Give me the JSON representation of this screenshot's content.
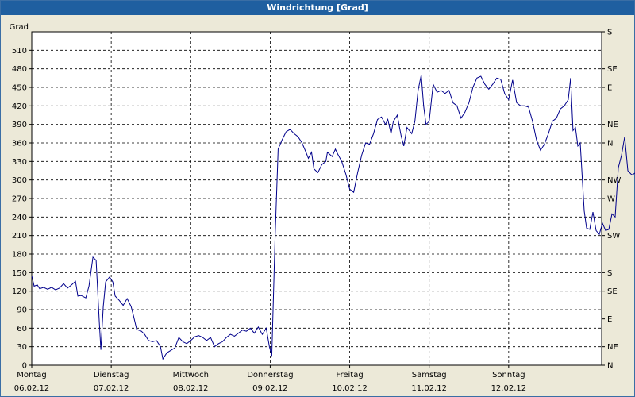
{
  "window": {
    "title": "Windrichtung [Grad]"
  },
  "chart_data": {
    "type": "line",
    "title": "Windrichtung [Grad]",
    "ylabel": "Grad",
    "ylim": [
      0,
      540
    ],
    "y_ticks": [
      0,
      30,
      60,
      90,
      120,
      150,
      180,
      210,
      240,
      270,
      300,
      330,
      360,
      390,
      420,
      450,
      480,
      510
    ],
    "right_ticks": [
      {
        "value": 0,
        "label": "N"
      },
      {
        "value": 30,
        "label": "NE"
      },
      {
        "value": 75,
        "label": "E"
      },
      {
        "value": 120,
        "label": "SE"
      },
      {
        "value": 150,
        "label": "S"
      },
      {
        "value": 210,
        "label": "SW"
      },
      {
        "value": 270,
        "label": "W"
      },
      {
        "value": 300,
        "label": "NW"
      },
      {
        "value": 360,
        "label": "N"
      },
      {
        "value": 390,
        "label": "NE"
      },
      {
        "value": 450,
        "label": "E"
      },
      {
        "value": 480,
        "label": "SE"
      },
      {
        "value": 540,
        "label": "S"
      }
    ],
    "x_days": [
      {
        "day": "Montag",
        "date": "06.02.12"
      },
      {
        "day": "Dienstag",
        "date": "07.02.12"
      },
      {
        "day": "Mittwoch",
        "date": "08.02.12"
      },
      {
        "day": "Donnerstag",
        "date": "09.02.12"
      },
      {
        "day": "Freitag",
        "date": "10.02.12"
      },
      {
        "day": "Samstag",
        "date": "11.02.12"
      },
      {
        "day": "Sonntag",
        "date": "12.02.12"
      }
    ],
    "xlim": [
      0,
      7
    ],
    "grid": true,
    "line_color": "#00008b",
    "series": [
      {
        "points": [
          [
            0.0,
            145
          ],
          [
            0.03,
            128
          ],
          [
            0.07,
            130
          ],
          [
            0.1,
            124
          ],
          [
            0.15,
            126
          ],
          [
            0.2,
            123
          ],
          [
            0.25,
            126
          ],
          [
            0.3,
            122
          ],
          [
            0.35,
            125
          ],
          [
            0.4,
            132
          ],
          [
            0.45,
            125
          ],
          [
            0.5,
            130
          ],
          [
            0.55,
            136
          ],
          [
            0.58,
            112
          ],
          [
            0.62,
            113
          ],
          [
            0.68,
            109
          ],
          [
            0.72,
            128
          ],
          [
            0.77,
            175
          ],
          [
            0.81,
            170
          ],
          [
            0.85,
            70
          ],
          [
            0.87,
            25
          ],
          [
            0.9,
            95
          ],
          [
            0.93,
            135
          ],
          [
            0.98,
            143
          ],
          [
            1.02,
            135
          ],
          [
            1.05,
            112
          ],
          [
            1.1,
            105
          ],
          [
            1.15,
            97
          ],
          [
            1.2,
            108
          ],
          [
            1.25,
            95
          ],
          [
            1.28,
            80
          ],
          [
            1.32,
            58
          ],
          [
            1.38,
            55
          ],
          [
            1.42,
            50
          ],
          [
            1.47,
            40
          ],
          [
            1.52,
            38
          ],
          [
            1.57,
            40
          ],
          [
            1.62,
            30
          ],
          [
            1.65,
            10
          ],
          [
            1.7,
            20
          ],
          [
            1.75,
            24
          ],
          [
            1.8,
            28
          ],
          [
            1.85,
            45
          ],
          [
            1.9,
            38
          ],
          [
            1.95,
            35
          ],
          [
            2.0,
            40
          ],
          [
            2.05,
            46
          ],
          [
            2.1,
            48
          ],
          [
            2.15,
            45
          ],
          [
            2.2,
            40
          ],
          [
            2.25,
            45
          ],
          [
            2.3,
            30
          ],
          [
            2.35,
            35
          ],
          [
            2.4,
            38
          ],
          [
            2.45,
            45
          ],
          [
            2.5,
            50
          ],
          [
            2.55,
            47
          ],
          [
            2.6,
            52
          ],
          [
            2.65,
            57
          ],
          [
            2.7,
            55
          ],
          [
            2.75,
            60
          ],
          [
            2.8,
            52
          ],
          [
            2.85,
            62
          ],
          [
            2.9,
            50
          ],
          [
            2.95,
            60
          ],
          [
            2.99,
            30
          ],
          [
            3.02,
            15
          ],
          [
            3.06,
            200
          ],
          [
            3.1,
            350
          ],
          [
            3.15,
            365
          ],
          [
            3.2,
            378
          ],
          [
            3.25,
            382
          ],
          [
            3.3,
            375
          ],
          [
            3.35,
            370
          ],
          [
            3.4,
            360
          ],
          [
            3.45,
            345
          ],
          [
            3.48,
            335
          ],
          [
            3.52,
            345
          ],
          [
            3.55,
            318
          ],
          [
            3.6,
            312
          ],
          [
            3.65,
            325
          ],
          [
            3.7,
            330
          ],
          [
            3.72,
            345
          ],
          [
            3.78,
            338
          ],
          [
            3.82,
            350
          ],
          [
            3.85,
            342
          ],
          [
            3.9,
            330
          ],
          [
            3.95,
            310
          ],
          [
            4.0,
            285
          ],
          [
            4.05,
            280
          ],
          [
            4.1,
            312
          ],
          [
            4.15,
            340
          ],
          [
            4.2,
            360
          ],
          [
            4.25,
            358
          ],
          [
            4.3,
            375
          ],
          [
            4.35,
            398
          ],
          [
            4.4,
            402
          ],
          [
            4.45,
            390
          ],
          [
            4.48,
            398
          ],
          [
            4.52,
            375
          ],
          [
            4.55,
            395
          ],
          [
            4.6,
            405
          ],
          [
            4.62,
            390
          ],
          [
            4.65,
            370
          ],
          [
            4.68,
            355
          ],
          [
            4.72,
            385
          ],
          [
            4.78,
            375
          ],
          [
            4.82,
            395
          ],
          [
            4.86,
            445
          ],
          [
            4.9,
            470
          ],
          [
            4.93,
            420
          ],
          [
            4.96,
            390
          ],
          [
            5.0,
            395
          ],
          [
            5.05,
            455
          ],
          [
            5.1,
            442
          ],
          [
            5.15,
            445
          ],
          [
            5.2,
            440
          ],
          [
            5.25,
            445
          ],
          [
            5.3,
            425
          ],
          [
            5.35,
            420
          ],
          [
            5.4,
            400
          ],
          [
            5.45,
            410
          ],
          [
            5.5,
            425
          ],
          [
            5.55,
            450
          ],
          [
            5.6,
            465
          ],
          [
            5.65,
            468
          ],
          [
            5.7,
            455
          ],
          [
            5.75,
            447
          ],
          [
            5.8,
            455
          ],
          [
            5.85,
            465
          ],
          [
            5.9,
            463
          ],
          [
            5.95,
            440
          ],
          [
            6.0,
            430
          ],
          [
            6.05,
            462
          ],
          [
            6.1,
            425
          ],
          [
            6.15,
            420
          ],
          [
            6.2,
            420
          ],
          [
            6.25,
            418
          ],
          [
            6.3,
            395
          ],
          [
            6.35,
            365
          ],
          [
            6.4,
            348
          ],
          [
            6.45,
            358
          ],
          [
            6.5,
            375
          ],
          [
            6.55,
            395
          ],
          [
            6.6,
            400
          ],
          [
            6.65,
            415
          ],
          [
            6.7,
            420
          ],
          [
            6.75,
            430
          ],
          [
            6.78,
            465
          ],
          [
            6.81,
            380
          ],
          [
            6.84,
            385
          ],
          [
            6.87,
            355
          ],
          [
            6.9,
            360
          ],
          [
            6.95,
            250
          ],
          [
            6.98,
            222
          ],
          [
            7.02,
            220
          ],
          [
            7.06,
            248
          ],
          [
            7.1,
            218
          ],
          [
            7.14,
            212
          ],
          [
            7.18,
            230
          ],
          [
            7.22,
            218
          ],
          [
            7.26,
            220
          ],
          [
            7.3,
            245
          ],
          [
            7.34,
            240
          ],
          [
            7.38,
            320
          ],
          [
            7.42,
            340
          ],
          [
            7.46,
            370
          ],
          [
            7.5,
            315
          ],
          [
            7.55,
            308
          ],
          [
            7.6,
            312
          ],
          [
            7.65,
            325
          ],
          [
            7.7,
            328
          ],
          [
            7.75,
            322
          ],
          [
            7.8,
            295
          ],
          [
            7.82,
            275
          ]
        ]
      }
    ]
  }
}
